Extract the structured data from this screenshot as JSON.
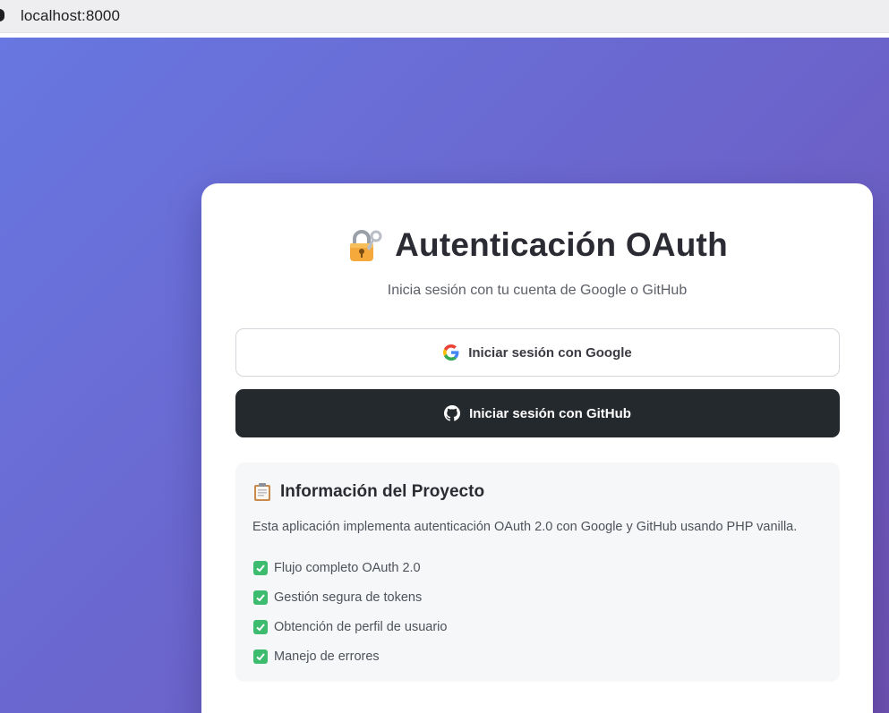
{
  "browser": {
    "url": "localhost:8000"
  },
  "card": {
    "lock_icon": "lock-with-key-icon",
    "title": "Autenticación OAuth",
    "subtitle": "Inicia sesión con tu cuenta de Google o GitHub"
  },
  "buttons": {
    "google": {
      "label": "Iniciar sesión con Google",
      "icon": "google-icon"
    },
    "github": {
      "label": "Iniciar sesión con GitHub",
      "icon": "github-icon"
    }
  },
  "info": {
    "icon": "clipboard-icon",
    "title": "Información del Proyecto",
    "description": "Esta aplicación implementa autenticación OAuth 2.0 con Google y GitHub usando PHP vanilla.",
    "features": [
      {
        "label": "Flujo completo OAuth 2.0",
        "icon": "check-icon"
      },
      {
        "label": "Gestión segura de tokens",
        "icon": "check-icon"
      },
      {
        "label": "Obtención de perfil de usuario",
        "icon": "check-icon"
      },
      {
        "label": "Manejo de errores",
        "icon": "check-icon"
      }
    ]
  },
  "colors": {
    "gradient_start": "#6877e1",
    "gradient_end": "#6f52b3",
    "github_button": "#24292e",
    "check_green": "#3dbb6f"
  }
}
